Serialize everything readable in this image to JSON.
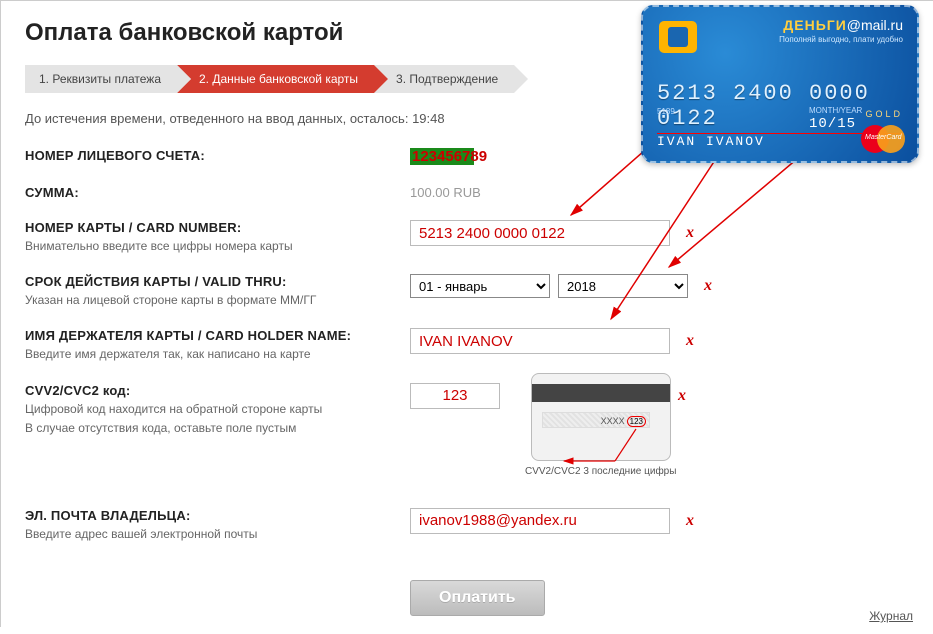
{
  "title": "Оплата банковской картой",
  "steps": {
    "s1": "1. Реквизиты платежа",
    "s2": "2. Данные банковской карты",
    "s3": "3. Подтверждение"
  },
  "timer_prefix": "До истечения времени, отведенного на ввод данных, осталось: ",
  "timer_value": "19:48",
  "fields": {
    "account": {
      "label": "НОМЕР ЛИЦЕВОГО СЧЕТА:",
      "value": "123456789"
    },
    "amount": {
      "label": "СУММА:",
      "value": "100.00 RUB"
    },
    "card_number": {
      "label": "НОМЕР КАРТЫ / CARD NUMBER:",
      "hint": "Внимательно введите все цифры номера карты",
      "value": "5213 2400 0000 0122"
    },
    "valid_thru": {
      "label": "СРОК ДЕЙСТВИЯ КАРТЫ / VALID THRU:",
      "hint": "Указан на лицевой стороне карты в формате ММ/ГГ",
      "month": "01 - январь",
      "year": "2018"
    },
    "holder": {
      "label": "ИМЯ ДЕРЖАТЕЛЯ КАРТЫ / CARD HOLDER NAME:",
      "hint": "Введите имя держателя так, как написано на карте",
      "value": "IVAN IVANOV"
    },
    "cvv": {
      "label": "CVV2/CVC2 код:",
      "hint1": "Цифровой код находится на обратной стороне карты",
      "hint2": "В случае отсутствия кода, оставьте поле пустым",
      "value": "123"
    },
    "email": {
      "label": "ЭЛ. ПОЧТА ВЛАДЕЛЬЦА:",
      "hint": "Введите адрес вашей электронной почты",
      "value": "ivanov1988@yandex.ru"
    }
  },
  "clear_x": "x",
  "pay_button": "Оплатить",
  "journal": "Журнал",
  "card": {
    "brand1": "ДЕНЬГИ",
    "brand2": "@mail.ru",
    "tagline": "Пополняй выгодно, плати удобно",
    "number": "5213 2400 0000 0122",
    "row4": "5189",
    "valid_label": "MONTH/YEAR",
    "expiry": "10/15",
    "gold": "GOLD",
    "holder": "IVAN IVANOV",
    "mc": "MasterCard"
  },
  "card_back": {
    "mask": "XXXX",
    "cvv": "123",
    "caption_b": "CVV2/CVC2",
    "caption": " 3 последние цифры"
  }
}
